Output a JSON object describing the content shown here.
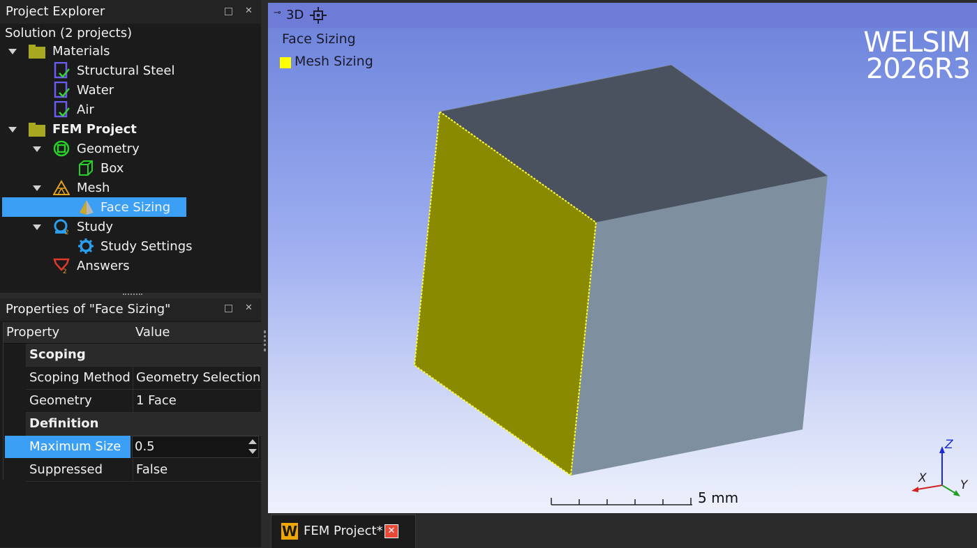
{
  "explorer": {
    "title": "Project Explorer",
    "solution": "Solution (2 projects)",
    "items": [
      {
        "label": "Materials",
        "icon": "folder-icon"
      },
      {
        "label": "Structural Steel",
        "icon": "material-icon"
      },
      {
        "label": "Water",
        "icon": "material-icon"
      },
      {
        "label": "Air",
        "icon": "material-icon"
      },
      {
        "label": "FEM Project",
        "icon": "folder-icon"
      },
      {
        "label": "Geometry",
        "icon": "geometry-icon"
      },
      {
        "label": "Box",
        "icon": "box-icon"
      },
      {
        "label": "Mesh",
        "icon": "mesh-icon"
      },
      {
        "label": "Face Sizing",
        "icon": "face-sizing-icon"
      },
      {
        "label": "Study",
        "icon": "study-icon"
      },
      {
        "label": "Study Settings",
        "icon": "study-settings-icon"
      },
      {
        "label": "Answers",
        "icon": "answers-icon"
      }
    ]
  },
  "properties": {
    "title": "Properties of \"Face Sizing\"",
    "header_property": "Property",
    "header_value": "Value",
    "sections": [
      {
        "name": "Scoping"
      },
      {
        "name": "Definition"
      }
    ],
    "rows": [
      {
        "property": "Scoping Method",
        "value": "Geometry Selection"
      },
      {
        "property": "Geometry",
        "value": "1 Face"
      },
      {
        "property": "Maximum Size",
        "value": "0.5"
      },
      {
        "property": "Suppressed",
        "value": "False"
      }
    ]
  },
  "viewport": {
    "tab_label": "3D",
    "title": "Face Sizing",
    "legend_label": "Mesh Sizing",
    "legend_color": "#ffff00",
    "watermark_line1": "WELSIM",
    "watermark_line2": "2026R3",
    "scale_label": "5 mm",
    "axis_x": "X",
    "axis_y": "Y",
    "axis_z": "Z"
  },
  "tabs": {
    "document": "FEM Project*",
    "app_icon_letter": "W"
  },
  "colors": {
    "selection": "#3a9ff5",
    "face_selected": "#8a8a00",
    "cube_top": "#4a5260",
    "cube_right": "#7e8fa0"
  }
}
